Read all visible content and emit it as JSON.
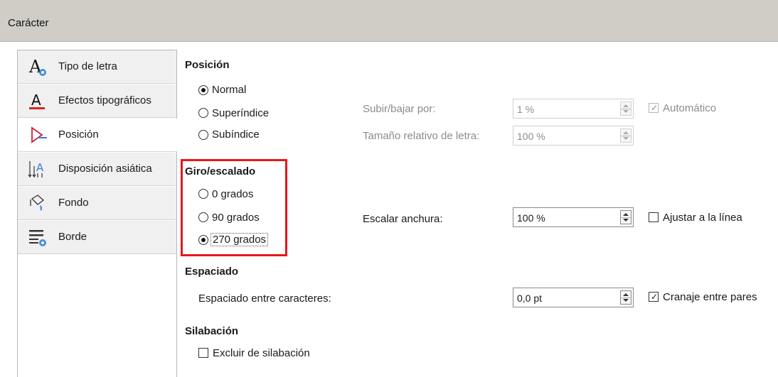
{
  "window": {
    "title": "Carácter"
  },
  "colors": {
    "highlight_box": "#e8171c",
    "titlebar": "#cfcdc5"
  },
  "sidebar": {
    "items": [
      {
        "label": "Tipo de letra",
        "icon": "font-icon"
      },
      {
        "label": "Efectos tipográficos",
        "icon": "font-effects-icon"
      },
      {
        "label": "Posición",
        "icon": "position-icon",
        "selected": true
      },
      {
        "label": "Disposición asiática",
        "icon": "asian-layout-icon"
      },
      {
        "label": "Fondo",
        "icon": "background-fill-icon"
      },
      {
        "label": "Borde",
        "icon": "border-icon"
      }
    ]
  },
  "position": {
    "heading": "Posición",
    "normal": "Normal",
    "superscript": "Superíndice",
    "subscript": "Subíndice",
    "raise_label": "Subir/bajar por:",
    "raise_value": "1 %",
    "auto_label": "Automático",
    "relsize_label": "Tamaño relativo de letra:",
    "relsize_value": "100 %"
  },
  "rotation": {
    "heading": "Giro/escalado",
    "deg0": "0 grados",
    "deg90": "90 grados",
    "deg270": "270 grados",
    "scale_label": "Escalar anchura:",
    "scale_value": "100 %",
    "fit_label": "Ajustar a la línea"
  },
  "spacing": {
    "heading": "Espaciado",
    "char_label": "Espaciado entre caracteres:",
    "char_value": "0,0 pt",
    "kerning_label": "Cranaje entre pares"
  },
  "hyphenation": {
    "heading": "Silabación",
    "exclude_label": "Excluir de silabación"
  }
}
